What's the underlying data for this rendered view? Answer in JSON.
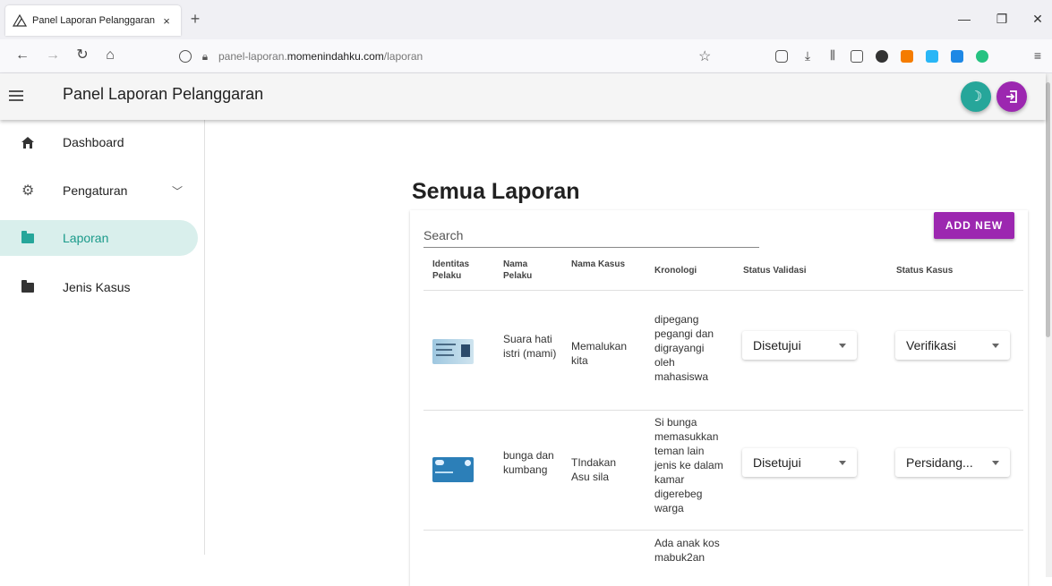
{
  "browser": {
    "tab_title": "Panel Laporan Pelanggaran",
    "tab_close": "×",
    "new_tab": "+",
    "url_host": "panel-laporan.",
    "url_domain": "momenindahku.com",
    "url_path": "/laporan",
    "controls": {
      "minimize": "—",
      "restore": "❐",
      "close": "✕"
    }
  },
  "app": {
    "title": "Panel Laporan Pelanggaran"
  },
  "sidebar": {
    "items": [
      {
        "label": "Dashboard",
        "icon": "home-icon"
      },
      {
        "label": "Pengaturan",
        "icon": "gear-icon"
      },
      {
        "label": "Laporan",
        "icon": "folder-icon",
        "active": true
      },
      {
        "label": "Jenis Kasus",
        "icon": "folder-icon"
      }
    ]
  },
  "main": {
    "heading": "Semua Laporan",
    "search_placeholder": "Search",
    "add_new_label": "ADD NEW",
    "columns": [
      "Identitas Pelaku",
      "Nama Pelaku",
      "Nama Kasus",
      "Kronologi",
      "Status Validasi",
      "Status Kasus"
    ],
    "rows": [
      {
        "nama_pelaku": "Suara hati istri (mami)",
        "nama_kasus": "Memalukan kita",
        "kronologi": "dipegang pegangi dan digrayangi oleh mahasiswa",
        "status_validasi": "Disetujui",
        "status_kasus": "Verifikasi"
      },
      {
        "nama_pelaku": "bunga dan kumbang",
        "nama_kasus": "TIndakan Asu sila",
        "kronologi": "Si bunga memasukkan teman lain jenis ke dalam kamar digerebeg warga",
        "status_validasi": "Disetujui",
        "status_kasus": "Persidang..."
      },
      {
        "kronologi": "Ada anak kos mabuk2an"
      }
    ]
  },
  "colors": {
    "accent": "#9c27b0",
    "active": "#26a69a",
    "theme_button": "#26a69a",
    "logout_button": "#9c27b0"
  }
}
